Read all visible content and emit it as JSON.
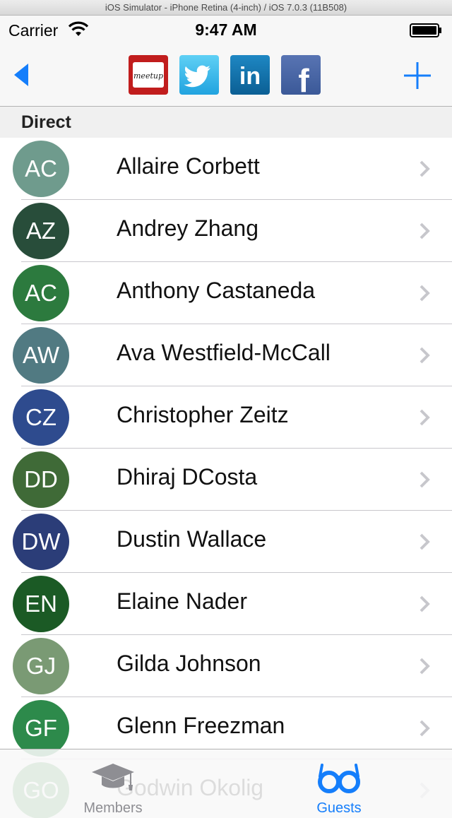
{
  "window": {
    "title": "iOS Simulator - iPhone Retina (4-inch) / iOS 7.0.3 (11B508)"
  },
  "status_bar": {
    "carrier": "Carrier",
    "time": "9:47 AM"
  },
  "nav": {
    "social_icons": [
      "meetup-icon",
      "twitter-icon",
      "linkedin-icon",
      "facebook-icon"
    ],
    "meetup_text": "meetup",
    "linkedin_text": "in",
    "facebook_text": "f",
    "tint_color": "#157efb"
  },
  "section": {
    "title": "Direct"
  },
  "contacts": [
    {
      "initials": "AC",
      "name": "Allaire Corbett",
      "color": "#6f9b8d"
    },
    {
      "initials": "AZ",
      "name": "Andrey Zhang",
      "color": "#284d3a"
    },
    {
      "initials": "AC",
      "name": "Anthony Castaneda",
      "color": "#2c7a3e"
    },
    {
      "initials": "AW",
      "name": "Ava Westfield-McCall",
      "color": "#517a82"
    },
    {
      "initials": "CZ",
      "name": "Christopher Zeitz",
      "color": "#2e4b8e"
    },
    {
      "initials": "DD",
      "name": "Dhiraj DCosta",
      "color": "#3f6a37"
    },
    {
      "initials": "DW",
      "name": "Dustin Wallace",
      "color": "#2b3d78"
    },
    {
      "initials": "EN",
      "name": "Elaine Nader",
      "color": "#1b5a25"
    },
    {
      "initials": "GJ",
      "name": "Gilda Johnson",
      "color": "#7a9a74"
    },
    {
      "initials": "GF",
      "name": "Glenn Freezman",
      "color": "#2d8a4b"
    },
    {
      "initials": "GO",
      "name": "Godwin Okolig",
      "color": "#4c9a55"
    }
  ],
  "tabs": [
    {
      "label": "Members",
      "icon": "graduation-cap-icon",
      "selected": false
    },
    {
      "label": "Guests",
      "icon": "glasses-icon",
      "selected": true
    }
  ]
}
